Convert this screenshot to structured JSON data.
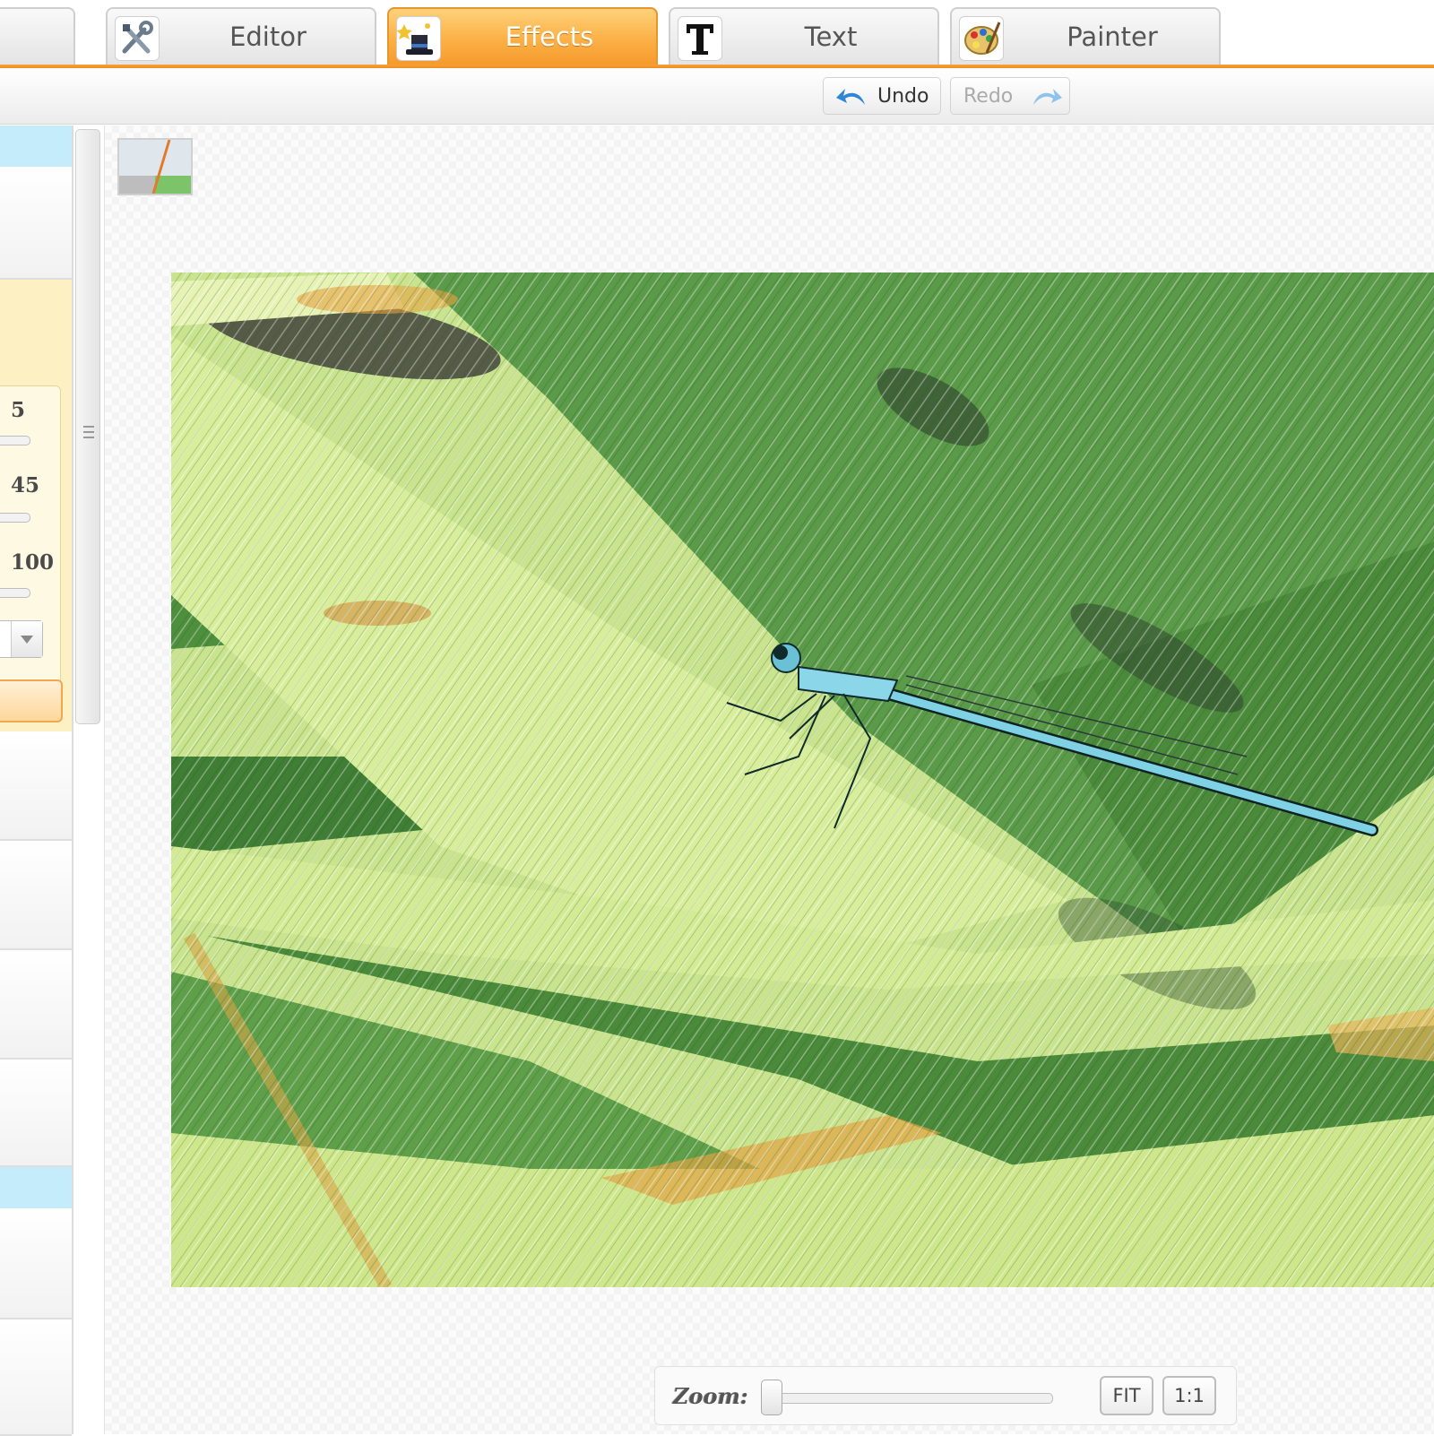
{
  "tabs": [
    {
      "label": "Editor",
      "icon": "tools-icon"
    },
    {
      "label": "Effects",
      "icon": "magic-hat-icon",
      "active": true
    },
    {
      "label": "Text",
      "icon": "text-t-icon"
    },
    {
      "label": "Painter",
      "icon": "palette-icon"
    }
  ],
  "toolbar": {
    "undo_label": "Undo",
    "redo_label": "Redo"
  },
  "left_panel": {
    "values": [
      "5",
      "45",
      "100"
    ]
  },
  "zoom": {
    "label": "Zoom:",
    "fit_label": "FIT",
    "one_to_one_label": "1:1",
    "level": 0
  },
  "colors": {
    "accent_orange": "#f69a2c",
    "panel_blue": "#c4ecfb",
    "settings_yellow": "#fdf0c2"
  }
}
